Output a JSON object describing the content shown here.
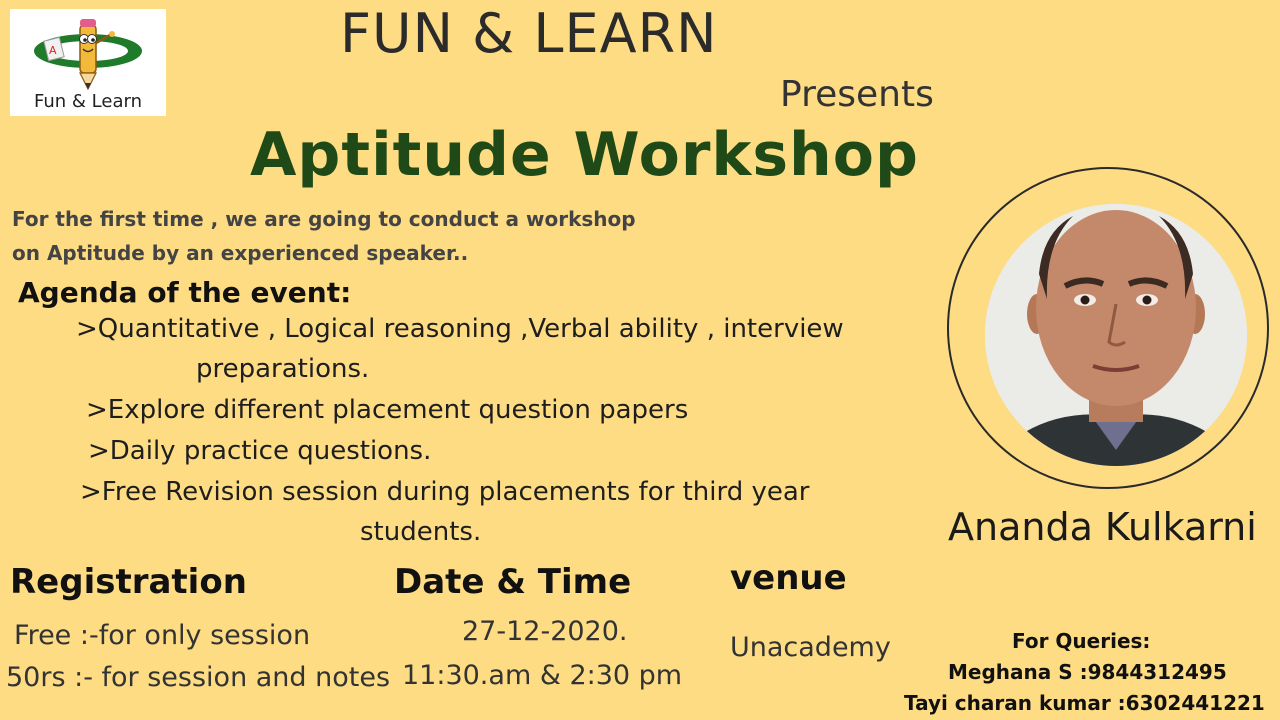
{
  "logo": {
    "text": "Fun & Learn",
    "icon": "cartoon-pencil-mascot-icon"
  },
  "header": {
    "brand": "FUN & LEARN",
    "presents": "Presents",
    "title": "Aptitude Workshop"
  },
  "intro": {
    "line1": "For the first time , we are going to conduct a workshop",
    "line2": "on Aptitude by an experienced speaker.."
  },
  "agenda": {
    "heading": "Agenda of the event:",
    "item1_line1": ">Quantitative , Logical reasoning  ,Verbal ability , interview",
    "item1_line2": "preparations.",
    "item2": ">Explore different placement question papers",
    "item3": ">Daily practice questions.",
    "item4_line1": ">Free Revision session during placements for third year",
    "item4_line2": "students."
  },
  "speaker": {
    "name": "Ananda Kulkarni"
  },
  "registration": {
    "heading": "Registration",
    "line1": "Free :-for only session",
    "line2": "50rs :- for session and notes"
  },
  "datetime": {
    "heading": "Date & Time",
    "date": "27-12-2020.",
    "time": "11:30.am & 2:30 pm"
  },
  "venue": {
    "heading": "venue",
    "place": "Unacademy"
  },
  "queries": {
    "heading": "For Queries:",
    "contact1": "Meghana S :9844312495",
    "contact2": "Tayi charan kumar :6302441221"
  },
  "colors": {
    "background": "#fddc84",
    "title_green": "#1f4a17",
    "logo_green": "#1f7a2a"
  }
}
